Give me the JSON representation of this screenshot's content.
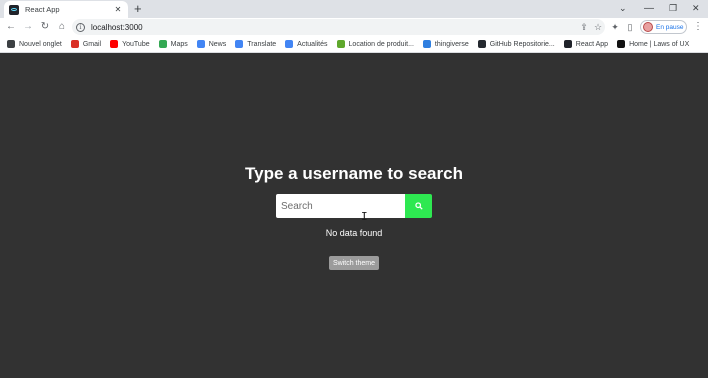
{
  "tab": {
    "title": "React App",
    "close": "✕",
    "new_tab": "+"
  },
  "window": {
    "chevron": "⌄",
    "minimize": "—",
    "maximize": "❐",
    "close": "✕"
  },
  "nav": {
    "back": "←",
    "forward": "→",
    "reload": "↻",
    "home": "⌂"
  },
  "address": {
    "url": "localhost:3000"
  },
  "toolbar": {
    "share": "⇪",
    "bookmark": "☆",
    "extensions": "✦",
    "sidepanel": "▯",
    "menu": "⋮"
  },
  "profile": {
    "label": "En pause"
  },
  "bookmarks": [
    {
      "label": "Nouvel onglet",
      "color": "#3c4043"
    },
    {
      "label": "Gmail",
      "color": "#d93025"
    },
    {
      "label": "YouTube",
      "color": "#ff0000"
    },
    {
      "label": "Maps",
      "color": "#34a853"
    },
    {
      "label": "News",
      "color": "#4285f4"
    },
    {
      "label": "Translate",
      "color": "#4285f4"
    },
    {
      "label": "Actualités",
      "color": "#4285f4"
    },
    {
      "label": "Location de produit...",
      "color": "#5fa82c"
    },
    {
      "label": "thingiverse",
      "color": "#2f7fe0"
    },
    {
      "label": "GitHub Repositorie...",
      "color": "#24292f"
    },
    {
      "label": "React App",
      "color": "#20232a"
    },
    {
      "label": "Home | Laws of UX",
      "color": "#111111"
    }
  ],
  "main": {
    "headline": "Type a username to search",
    "search_placeholder": "Search",
    "status": "No data found",
    "theme_button": "Switch theme"
  },
  "colors": {
    "accent_green": "#2ee851",
    "background": "#323232"
  }
}
